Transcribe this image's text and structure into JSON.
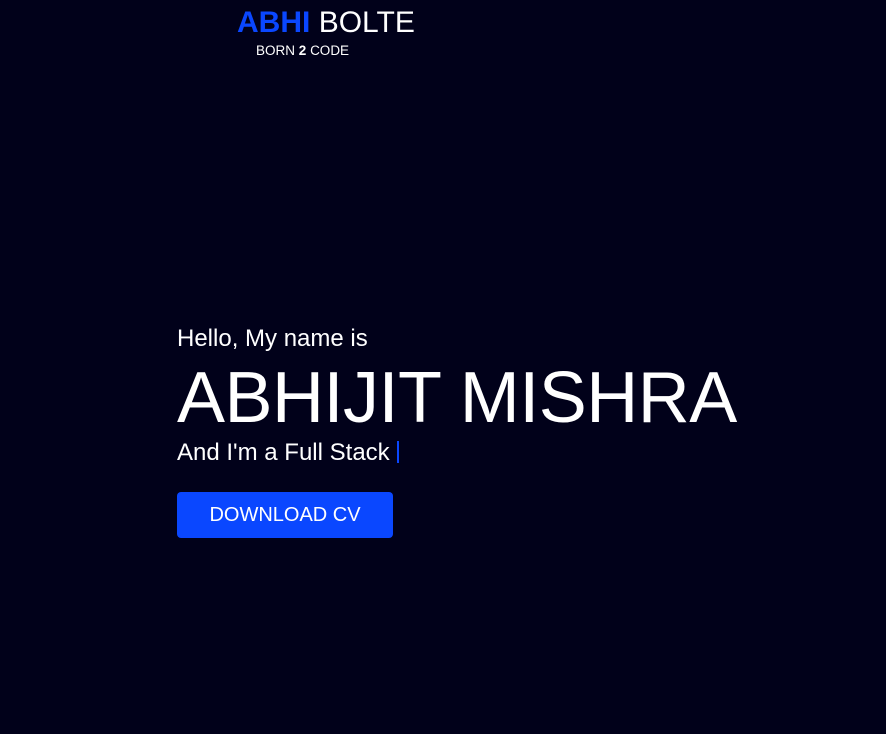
{
  "logo": {
    "first": "ABHI",
    "last": "BOLTE",
    "tag_pre": "BORN",
    "tag_num": "2",
    "tag_post": "CODE"
  },
  "hero": {
    "greeting": "Hello, My name is",
    "name": "ABHIJIT MISHRA",
    "role": "And I'm a Full Stack",
    "cv_button": "DOWNLOAD CV"
  },
  "colors": {
    "background": "#01011a",
    "accent": "#0a47ff",
    "text": "#ffffff"
  }
}
